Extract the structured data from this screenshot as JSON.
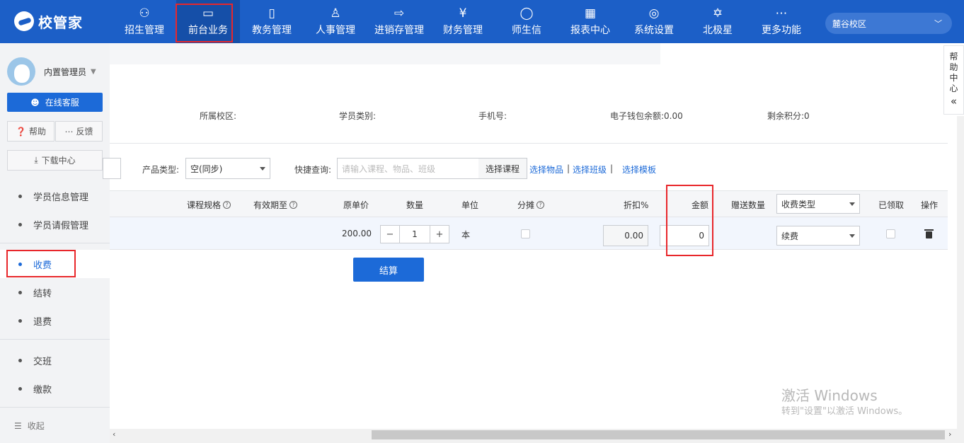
{
  "brand": {
    "name": "校管家"
  },
  "nav": {
    "items": [
      {
        "label": "招生管理",
        "icon": "⚇"
      },
      {
        "label": "前台业务",
        "icon": "▭"
      },
      {
        "label": "教务管理",
        "icon": "▯"
      },
      {
        "label": "人事管理",
        "icon": "♙"
      },
      {
        "label": "进销存管理",
        "icon": "⇨"
      },
      {
        "label": "财务管理",
        "icon": "¥"
      },
      {
        "label": "师生信",
        "icon": "◯"
      },
      {
        "label": "报表中心",
        "icon": "▦"
      },
      {
        "label": "系统设置",
        "icon": "◎"
      },
      {
        "label": "北极星",
        "icon": "✡"
      },
      {
        "label": "更多功能",
        "icon": "⋯"
      }
    ],
    "active": "前台业务",
    "campus": "麓谷校区"
  },
  "sidebar": {
    "user": "内置管理员",
    "service_btn": "在线客服",
    "help_btn": "帮助",
    "feedback_btn": "反馈",
    "download_btn": "下载中心",
    "menu": [
      {
        "label": "学员信息管理"
      },
      {
        "label": "学员请假管理"
      },
      {
        "label": "收费"
      },
      {
        "label": "结转"
      },
      {
        "label": "退费"
      },
      {
        "label": "交班"
      },
      {
        "label": "缴款"
      }
    ],
    "active_menu": "收费",
    "collapse": "收起"
  },
  "info": {
    "campus_label": "所属校区:",
    "student_type_label": "学员类别:",
    "phone_label": "手机号:",
    "wallet_label": "电子钱包余额:",
    "wallet_value": "0.00",
    "points_label": "剩余积分:",
    "points_value": "0"
  },
  "filters": {
    "product_type_label": "产品类型:",
    "product_type_value": "空(同步)",
    "quick_search_label": "快捷查询:",
    "quick_search_placeholder": "请输入课程、物品、班级",
    "select_course": "选择课程",
    "select_goods": "选择物品",
    "select_class": "选择班级",
    "select_template": "选择模板",
    "pipe": "|"
  },
  "table": {
    "headers": {
      "spec": "课程规格",
      "valid_until": "有效期至",
      "unit_price": "原单价",
      "quantity": "数量",
      "unit": "单位",
      "apportion": "分摊",
      "discount": "折扣%",
      "amount": "金额",
      "gift_qty": "赠送数量",
      "fee_type": "收费类型",
      "received": "已领取",
      "action": "操作"
    },
    "row": {
      "unit_price": "200.00",
      "quantity": "1",
      "unit": "本",
      "discount": "0.00",
      "amount": "0",
      "fee_type": "续费"
    },
    "minus": "−",
    "plus": "+"
  },
  "settle_btn": "结算",
  "help_side": [
    "帮",
    "助",
    "中",
    "心"
  ],
  "help_side_arrow": "«",
  "watermark": {
    "line1": "激活 Windows",
    "line2": "转到\"设置\"以激活 Windows。"
  }
}
